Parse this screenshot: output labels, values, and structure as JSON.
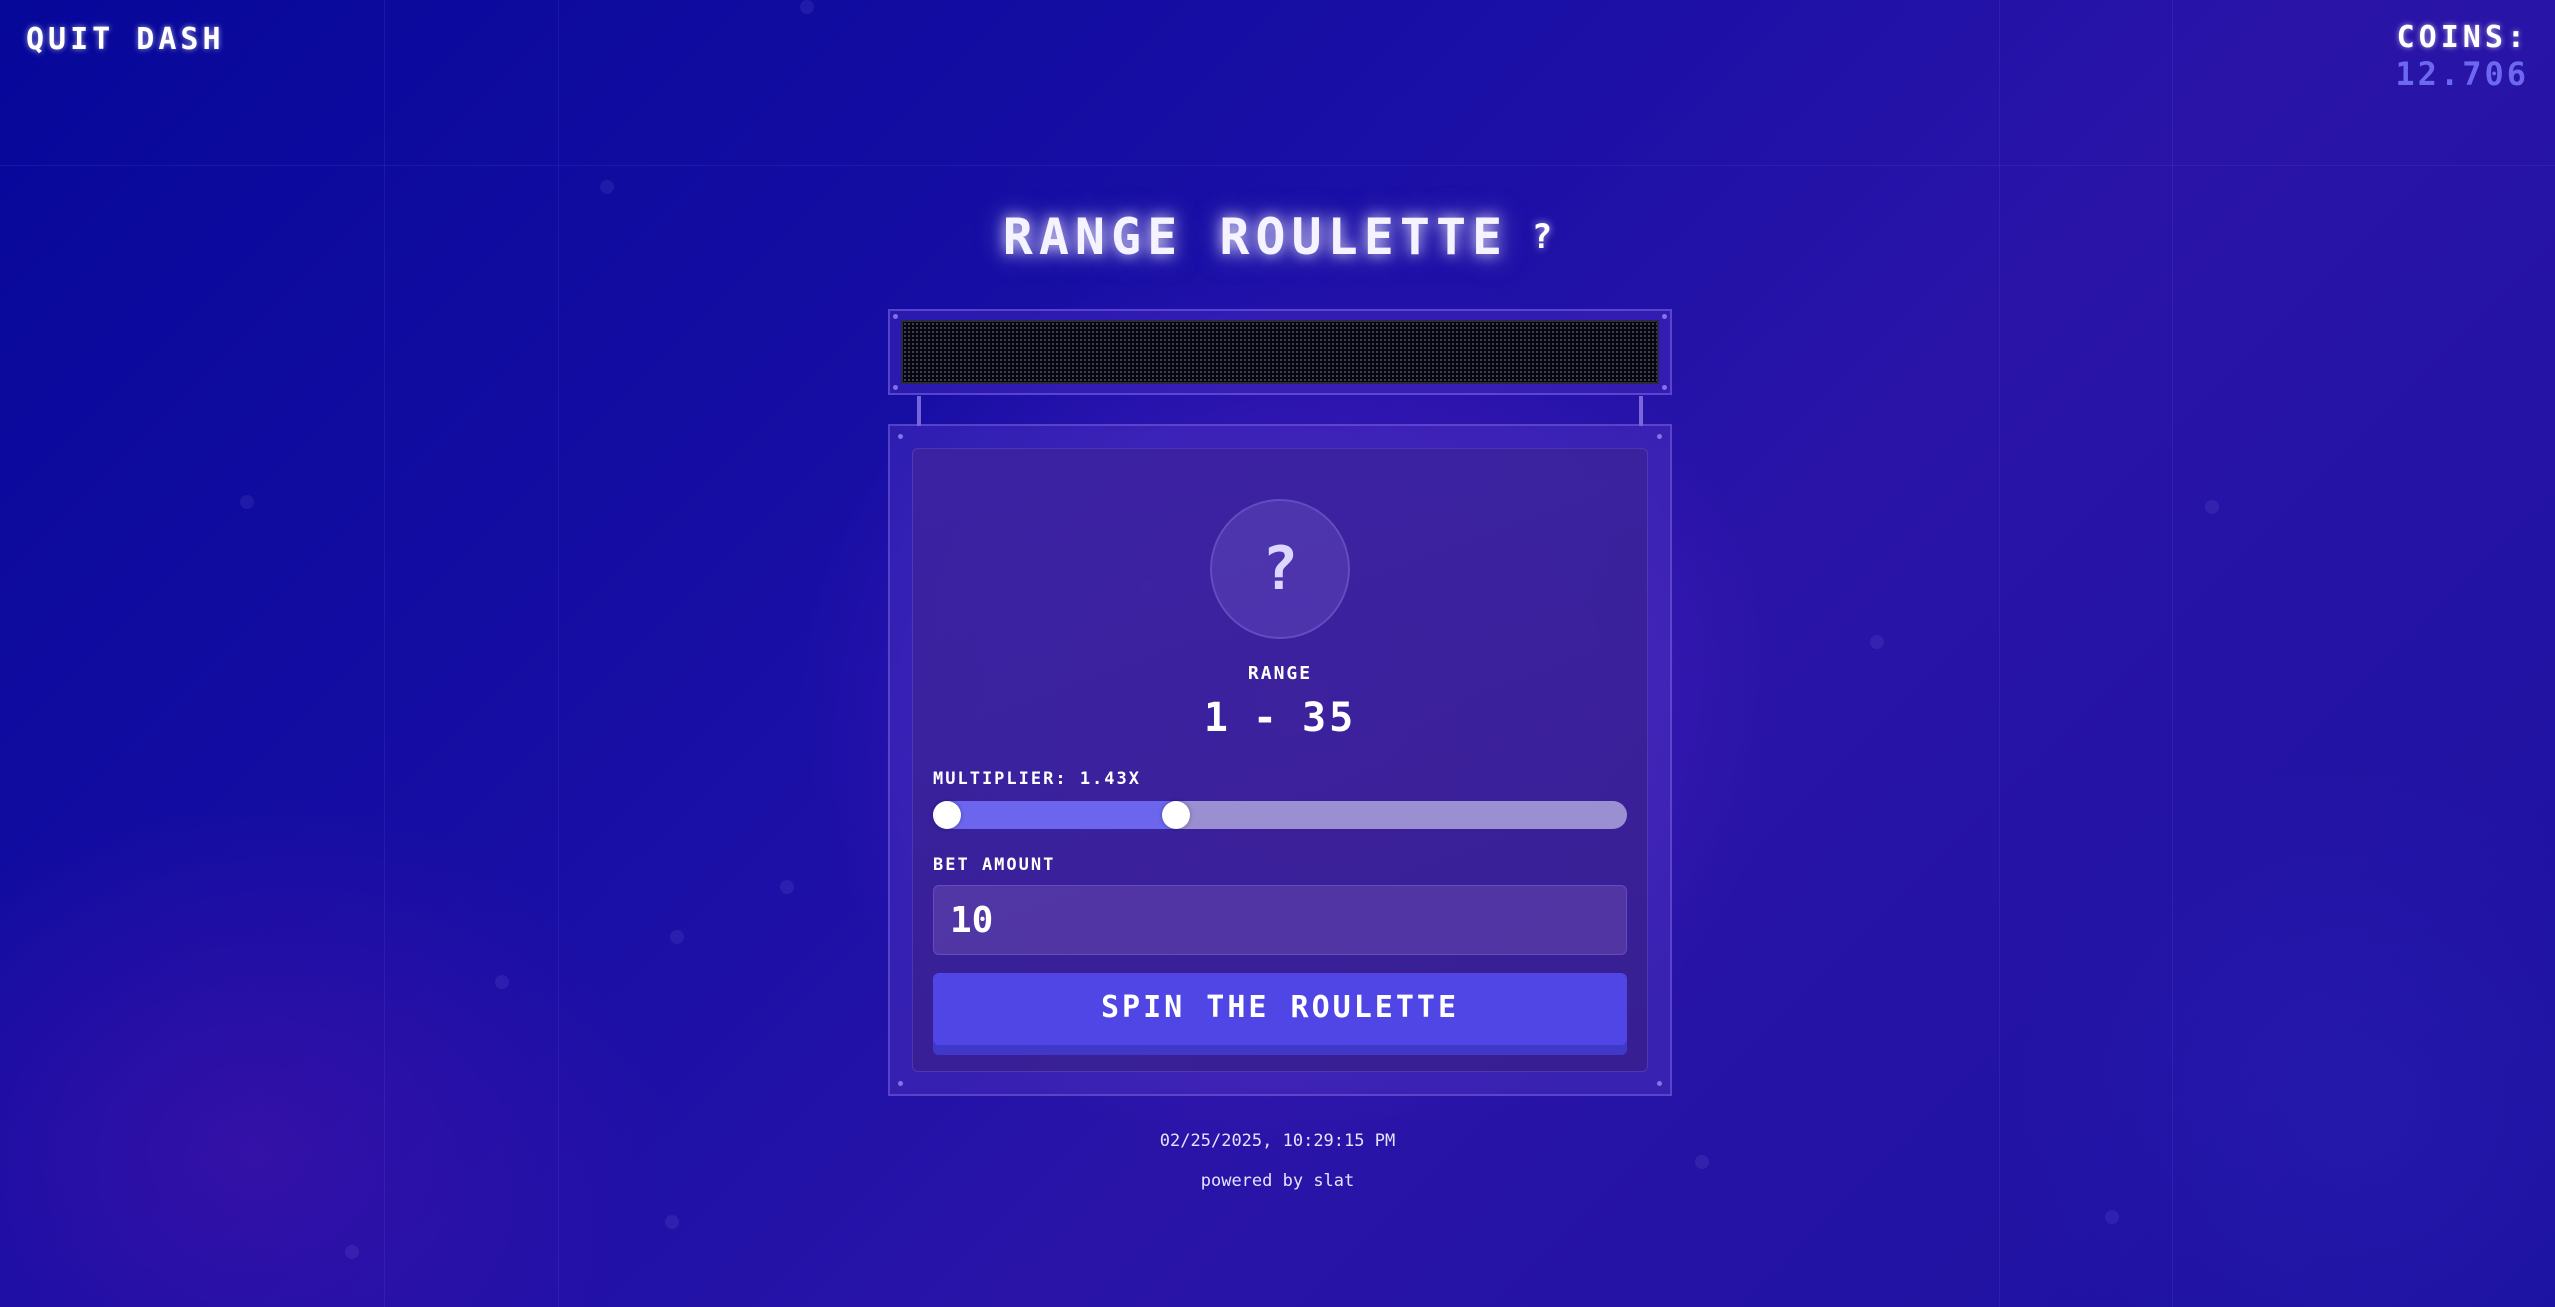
{
  "header": {
    "quit_label": "QUIT DASH",
    "coins_label": "COINS:",
    "coins_value": "12.706"
  },
  "game": {
    "title": "RANGE ROULETTE",
    "help_icon": "?",
    "result_symbol": "?",
    "range_label": "RANGE",
    "range_min": "1",
    "range_separator": "-",
    "range_max": "35",
    "multiplier_label": "MULTIPLIER: 1.43X",
    "slider": {
      "min_value": 1,
      "max_value": 35,
      "scale_max": 100
    },
    "bet_label": "BET AMOUNT",
    "bet_value": "10",
    "spin_label": "SPIN THE ROULETTE"
  },
  "footer": {
    "timestamp": "02/25/2025, 10:29:15 PM",
    "powered_by": "powered by slat"
  },
  "colors": {
    "accent": "#5046e5",
    "coins": "#6d68f0",
    "slider_fill": "#6c66ee",
    "slider_track": "#9a8fd0"
  }
}
